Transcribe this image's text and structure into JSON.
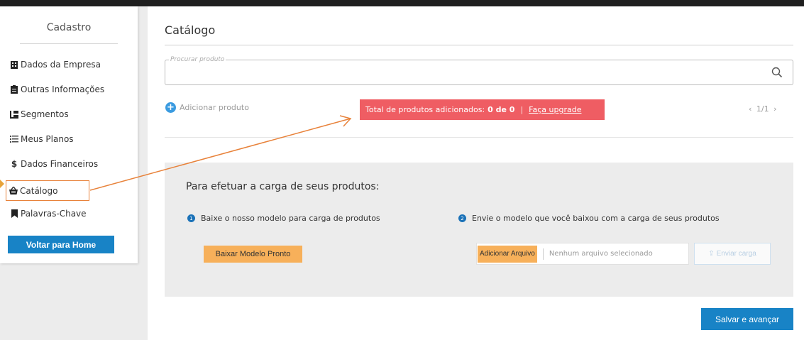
{
  "sidebar": {
    "title": "Cadastro",
    "items": [
      {
        "label": "Dados da Empresa",
        "icon": "building-icon"
      },
      {
        "label": "Outras Informações",
        "icon": "clipboard-icon"
      },
      {
        "label": "Segmentos",
        "icon": "segments-icon"
      },
      {
        "label": "Meus Planos",
        "icon": "list-icon"
      },
      {
        "label": "Dados Financeiros",
        "icon": "dollar-icon"
      },
      {
        "label": "Catálogo",
        "icon": "basket-icon",
        "active": true
      },
      {
        "label": "Palavras-Chave",
        "icon": "bookmark-icon"
      }
    ],
    "home_button": "Voltar para Home"
  },
  "main": {
    "title": "Catálogo",
    "search": {
      "legend": "Procurar produto",
      "value": "",
      "icon": "search-icon"
    },
    "add_product_label": "Adicionar produto",
    "total_banner": {
      "label": "Total de produtos adicionados:",
      "count": "0 de 0",
      "separator": "|",
      "upgrade_link": "Faça upgrade"
    },
    "pager": {
      "prev": "‹",
      "text": "1/1",
      "next": "›"
    },
    "upload": {
      "heading": "Para efetuar a carga de seus produtos:",
      "step1": {
        "number": "1",
        "text": "Baixe o nosso modelo para carga de produtos"
      },
      "step2": {
        "number": "2",
        "text": "Envie o modelo que você baixou com a carga de seus produtos"
      },
      "download_button": "Baixar Modelo Pronto",
      "add_file_button": "Adicionar Arquivo",
      "file_status": "Nenhum arquivo selecionado",
      "send_button": "Enviar carga"
    },
    "save_button": "Salvar e avançar"
  },
  "colors": {
    "primary": "#1883c6",
    "banner": "#ef5d63",
    "orange_button": "#f7b05a",
    "annotation": "#e8823a"
  }
}
